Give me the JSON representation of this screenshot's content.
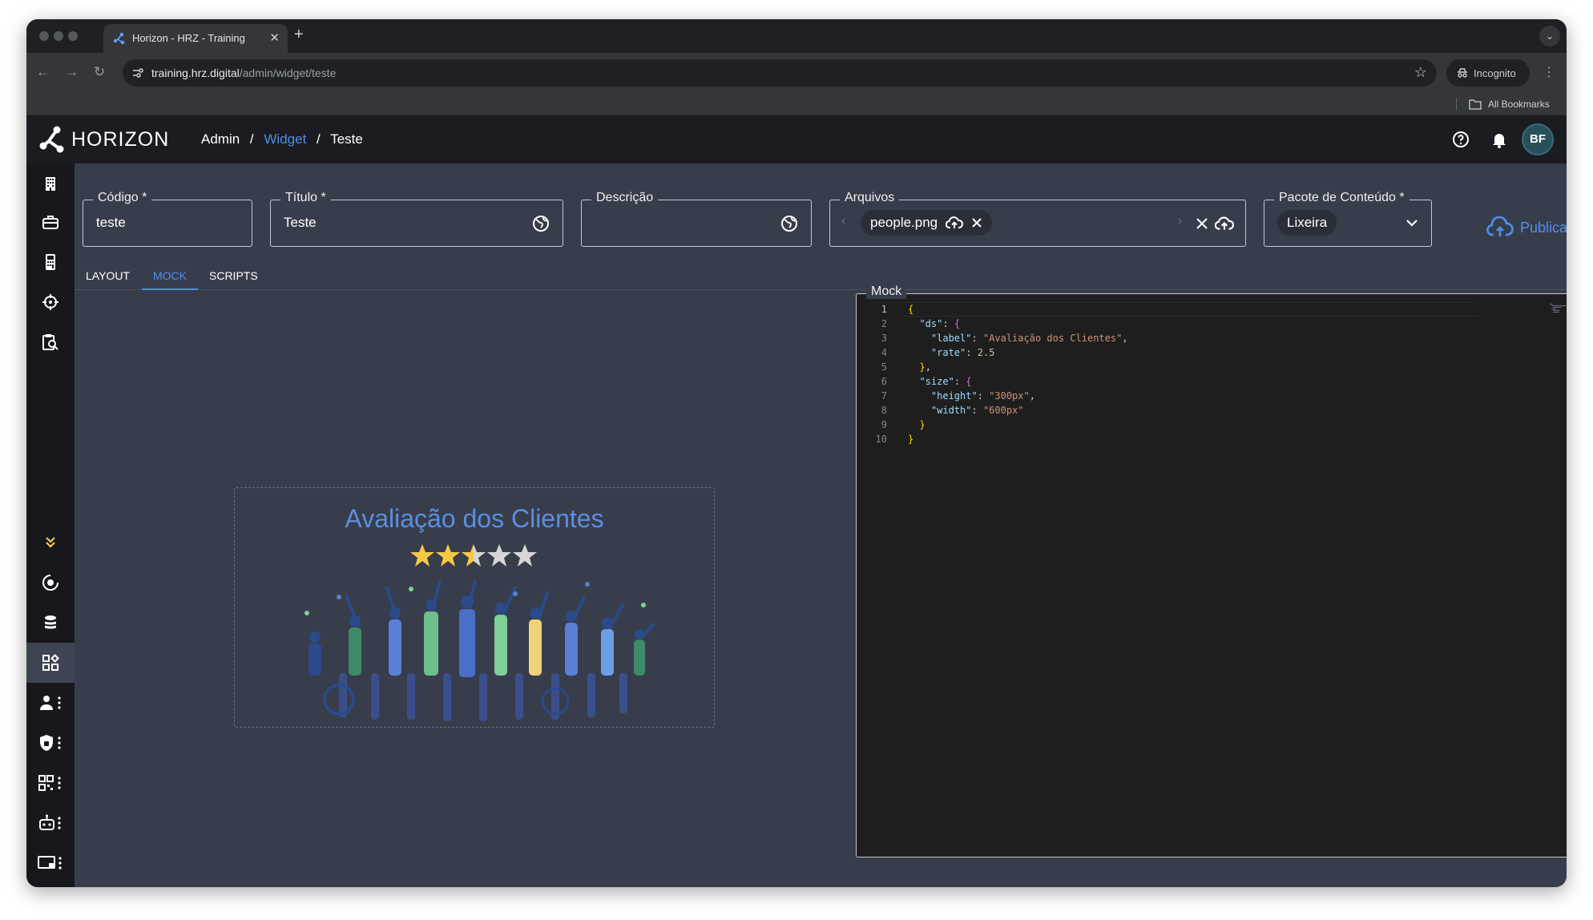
{
  "browser": {
    "tab_title": "Horizon - HRZ - Training",
    "url_host": "training.hrz.digital",
    "url_path": "/admin/widget/teste",
    "incognito_label": "Incognito",
    "bookmarks_label": "All Bookmarks"
  },
  "header": {
    "brand": "HORIZON",
    "breadcrumb": [
      "Admin",
      "Widget",
      "Teste"
    ],
    "separator": "/",
    "avatar_initials": "BF"
  },
  "sidebar": {
    "items": [
      {
        "icon": "building-icon",
        "active": false
      },
      {
        "icon": "briefcase-icon",
        "active": false
      },
      {
        "icon": "calculator-icon",
        "active": false
      },
      {
        "icon": "crosshair-icon",
        "active": false
      },
      {
        "icon": "clipboard-search-icon",
        "active": false
      },
      {
        "icon": "chevrons-down-icon",
        "active": false
      },
      {
        "icon": "target-circle-icon",
        "active": false
      },
      {
        "icon": "database-icon",
        "active": false
      },
      {
        "icon": "widgets-icon",
        "active": true
      },
      {
        "icon": "user-menu-icon",
        "active": false
      },
      {
        "icon": "shield-menu-icon",
        "active": false
      },
      {
        "icon": "qr-menu-icon",
        "active": false
      },
      {
        "icon": "robot-menu-icon",
        "active": false
      },
      {
        "icon": "screen-menu-icon",
        "active": false
      }
    ]
  },
  "form": {
    "codigo": {
      "label": "Código *",
      "value": "teste"
    },
    "titulo": {
      "label": "Título *",
      "value": "Teste"
    },
    "descricao": {
      "label": "Descrição",
      "value": ""
    },
    "arquivos": {
      "label": "Arquivos",
      "file": "people.png"
    },
    "pacote": {
      "label": "Pacote de Conteúdo *",
      "value": "Lixeira"
    },
    "publish_label": "Publicar"
  },
  "tabs": [
    {
      "label": "LAYOUT",
      "active": false
    },
    {
      "label": "MOCK",
      "active": true
    },
    {
      "label": "SCRIPTS",
      "active": false
    }
  ],
  "preview": {
    "title": "Avaliação dos Clientes",
    "rating": 2.5,
    "max_rating": 5,
    "star_color": "#f6c944",
    "star_empty_color": "#d6d6d6"
  },
  "mock": {
    "label": "Mock",
    "lines": [
      "{",
      "  \"ds\": {",
      "    \"label\": \"Avaliação dos Clientes\",",
      "    \"rate\": 2.5",
      "  },",
      "  \"size\": {",
      "    \"height\": \"300px\",",
      "    \"width\": \"600px\"",
      "  }",
      "}"
    ]
  },
  "colors": {
    "accent": "#4f8fee",
    "app_bg": "#383d4b",
    "sidebar_bg": "#16181c",
    "header_bg": "#1a1c21"
  }
}
